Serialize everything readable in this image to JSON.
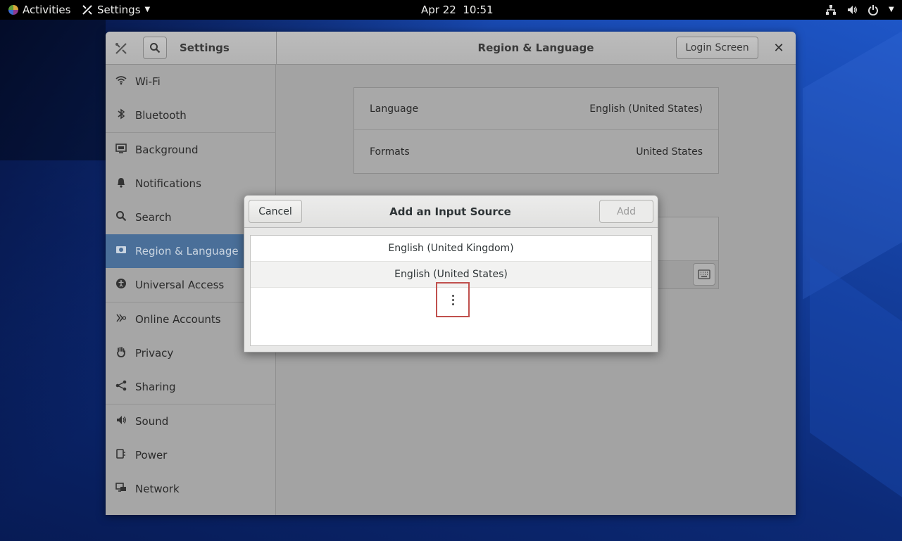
{
  "topbar": {
    "activities_label": "Activities",
    "app_menu_label": "Settings",
    "date": "Apr 22",
    "time": "10:51",
    "tray_icons": [
      "network-icon",
      "volume-icon",
      "power-icon"
    ]
  },
  "window": {
    "sidebar_title": "Settings",
    "panel_title": "Region & Language",
    "login_screen_label": "Login Screen",
    "close_label": "✕"
  },
  "sidebar": {
    "items": [
      {
        "label": "Wi-Fi",
        "icon": "wifi-icon"
      },
      {
        "label": "Bluetooth",
        "icon": "bluetooth-icon"
      },
      {
        "label": "Background",
        "icon": "background-icon"
      },
      {
        "label": "Notifications",
        "icon": "bell-icon"
      },
      {
        "label": "Search",
        "icon": "search-icon"
      },
      {
        "label": "Region & Language",
        "icon": "region-icon",
        "active": true
      },
      {
        "label": "Universal Access",
        "icon": "accessibility-icon"
      },
      {
        "label": "Online Accounts",
        "icon": "online-accounts-icon"
      },
      {
        "label": "Privacy",
        "icon": "hand-icon"
      },
      {
        "label": "Sharing",
        "icon": "share-icon"
      },
      {
        "label": "Sound",
        "icon": "speaker-icon"
      },
      {
        "label": "Power",
        "icon": "power-plug-icon"
      },
      {
        "label": "Network",
        "icon": "network-icon"
      }
    ]
  },
  "region": {
    "language_label": "Language",
    "language_value": "English (United States)",
    "formats_label": "Formats",
    "formats_value": "United States"
  },
  "dialog": {
    "title": "Add an Input Source",
    "cancel_label": "Cancel",
    "add_label": "Add",
    "options": [
      "English (United Kingdom)",
      "English (United States)"
    ]
  },
  "colors": {
    "highlight_border": "#c0504d",
    "sidebar_active": "#4a6f99"
  }
}
